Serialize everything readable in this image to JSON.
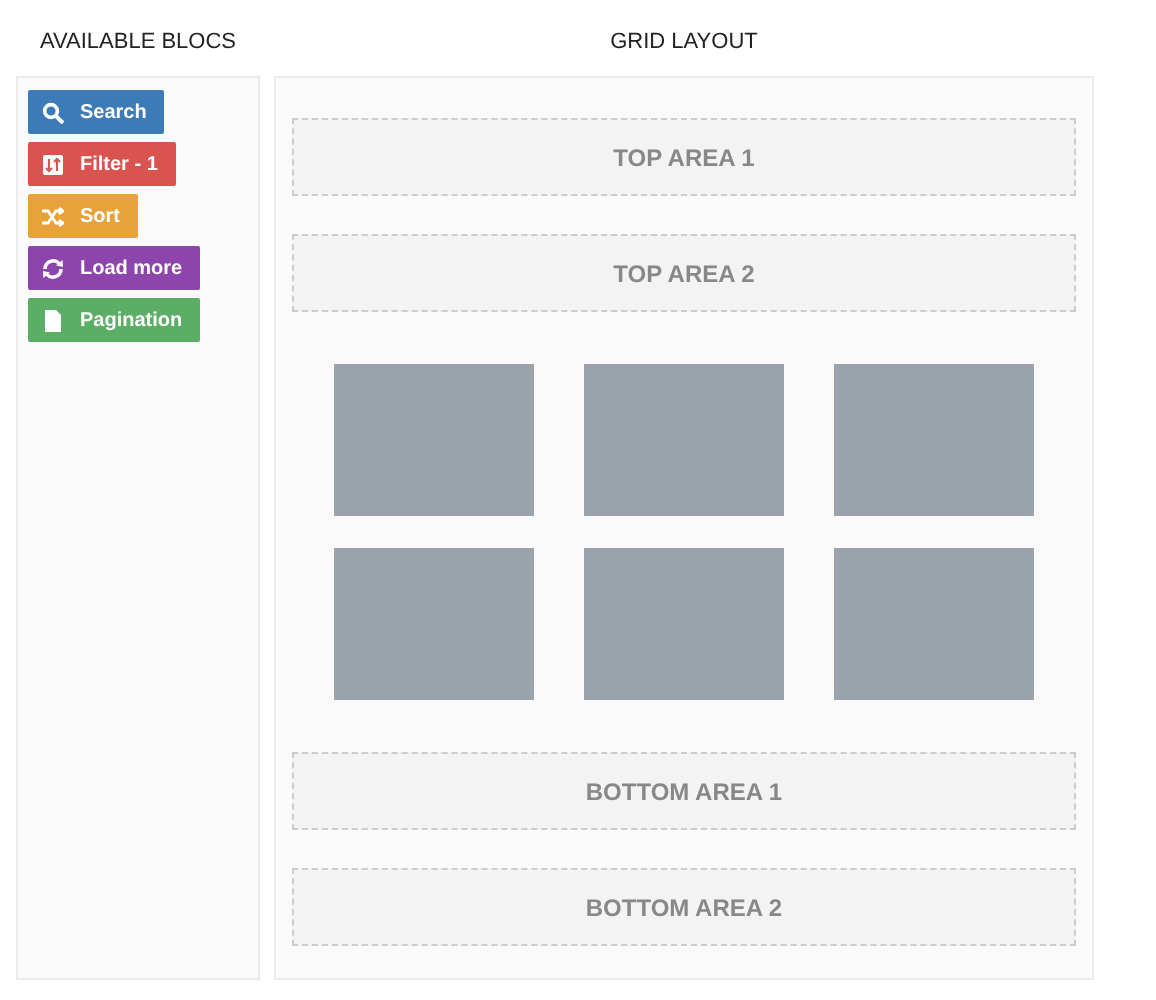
{
  "blocs_panel": {
    "title": "AVAILABLE BLOCS",
    "blocs": [
      {
        "label": "Search",
        "kind": "search",
        "color": "#3d7ab8"
      },
      {
        "label": "Filter - 1",
        "kind": "filter",
        "color": "#d9534f"
      },
      {
        "label": "Sort",
        "kind": "sort",
        "color": "#e8a23c"
      },
      {
        "label": "Load more",
        "kind": "reload",
        "color": "#8e44ad"
      },
      {
        "label": "Pagination",
        "kind": "page",
        "color": "#5cae66"
      }
    ]
  },
  "grid_layout": {
    "title": "GRID LAYOUT",
    "top_areas": [
      "TOP AREA 1",
      "TOP AREA 2"
    ],
    "grid_items": [
      {
        "kind": "tile"
      },
      {
        "kind": "tile"
      },
      {
        "kind": "tile"
      },
      {
        "kind": "tile"
      },
      {
        "kind": "tile"
      },
      {
        "kind": "tile"
      }
    ],
    "bottom_areas": [
      "BOTTOM AREA 1",
      "BOTTOM AREA 2"
    ]
  }
}
